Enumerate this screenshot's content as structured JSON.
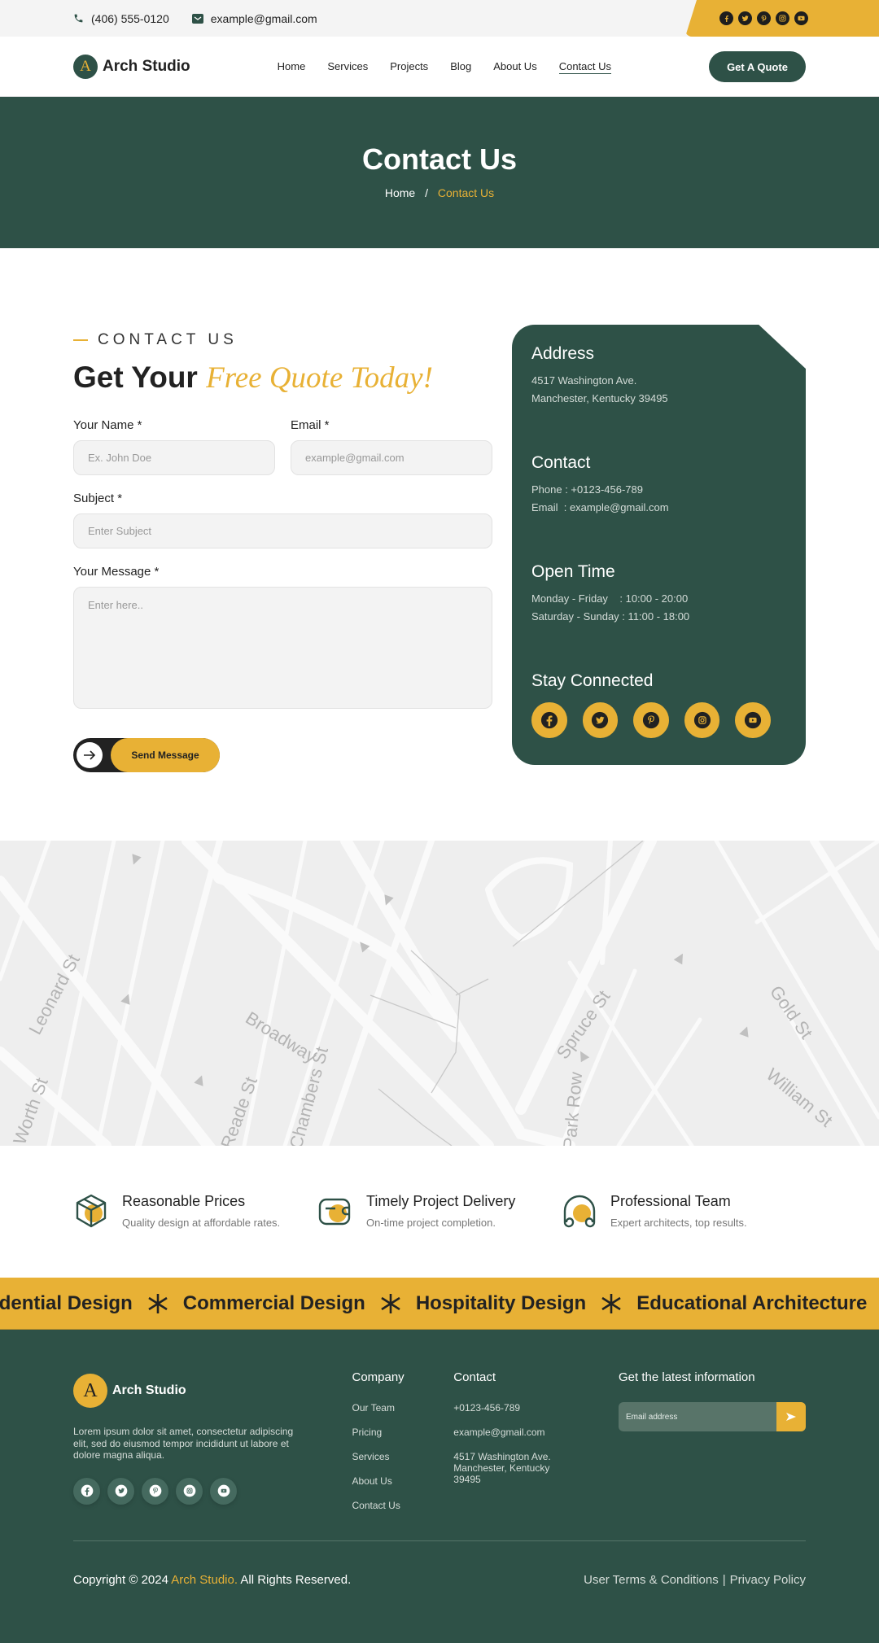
{
  "topbar": {
    "phone": "(406) 555-0120",
    "email": "example@gmail.com",
    "social_icons": [
      "facebook-icon",
      "twitter-icon",
      "pinterest-icon",
      "instagram-icon",
      "youtube-icon"
    ]
  },
  "nav": {
    "logo_letter": "A",
    "logo_name": "Arch Studio",
    "items": [
      {
        "label": "Home",
        "active": false
      },
      {
        "label": "Services",
        "active": false
      },
      {
        "label": "Projects",
        "active": false
      },
      {
        "label": "Blog",
        "active": false
      },
      {
        "label": "About Us",
        "active": false
      },
      {
        "label": "Contact Us",
        "active": true
      }
    ],
    "cta": "Get A Quote"
  },
  "hero": {
    "title": "Contact Us",
    "breadcrumb": {
      "home": "Home",
      "separator": "/",
      "current": "Contact Us"
    }
  },
  "form": {
    "eyebrow": "CONTACT US",
    "headline_plain": "Get Your",
    "headline_script": "Free Quote Today!",
    "name_label": "Your Name *",
    "name_placeholder": "Ex. John Doe",
    "email_label": "Email *",
    "email_placeholder": "example@gmail.com",
    "subject_label": "Subject *",
    "subject_placeholder": "Enter Subject",
    "message_label": "Your Message *",
    "message_placeholder": "Enter here..",
    "submit": "Send Message"
  },
  "info_card": {
    "address_title": "Address",
    "address_line1": "4517 Washington Ave.",
    "address_line2": "Manchester, Kentucky 39495",
    "contact_title": "Contact",
    "phone_line": "Phone : +0123-456-789",
    "email_line": "Email  : example@gmail.com",
    "hours_title": "Open Time",
    "hours_weekday": "Monday - Friday    : 10:00 - 20:00",
    "hours_weekend": "Saturday - Sunday : 11:00 - 18:00",
    "social_title": "Stay Connected"
  },
  "map": {
    "street_labels": [
      "Leonard St",
      "Broadway",
      "Worth St",
      "Reade St",
      "Chambers St",
      "Spruce St",
      "Park Row",
      "Gold St",
      "William St"
    ]
  },
  "features": [
    {
      "icon": "box-icon",
      "title": "Reasonable Prices",
      "desc": "Quality design at affordable rates."
    },
    {
      "icon": "wallet-icon",
      "title": "Timely Project Delivery",
      "desc": "On-time project completion."
    },
    {
      "icon": "headphones-icon",
      "title": "Professional Team",
      "desc": "Expert architects, top results."
    }
  ],
  "marquee": [
    "Residential Design",
    "Commercial Design",
    "Hospitality Design",
    "Educational Architecture"
  ],
  "footer": {
    "logo_letter": "A",
    "logo_name": "Arch Studio",
    "description": "Lorem ipsum dolor sit amet, consectetur adipiscing elit, sed do eiusmod tempor incididunt ut labore et dolore magna aliqua.",
    "company_title": "Company",
    "company_links": [
      "Our Team",
      "Pricing",
      "Services",
      "About Us",
      "Contact Us"
    ],
    "contact_title": "Contact",
    "contact_phone": "+0123-456-789",
    "contact_email": "example@gmail.com",
    "contact_address": "4517 Washington Ave. Manchester, Kentucky 39495",
    "newsletter_title": "Get the latest information",
    "newsletter_placeholder": "Email address",
    "copyright_prefix": "Copyright © 2024 ",
    "copyright_brand": "Arch Studio.",
    "copyright_suffix": " All Rights Reserved.",
    "terms": "User Terms & Conditions",
    "divider": "|",
    "privacy": "Privacy Policy"
  },
  "colors": {
    "primary_green": "#2e5147",
    "accent_yellow": "#e8b135",
    "text_dark": "#222222"
  }
}
